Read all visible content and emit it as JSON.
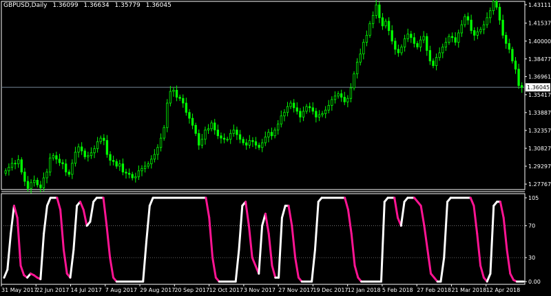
{
  "header": {
    "symbol": "GBPUSD,Daily",
    "open": "1.36099",
    "high": "1.36634",
    "low": "1.35779",
    "close": "1.36045"
  },
  "colors": {
    "background": "#000000",
    "bull_candle": "#00ff00",
    "bear_candle": "#00ff00",
    "bid_line": "#778899",
    "osc_up": "#ffffff",
    "osc_down": "#ff1493",
    "level_line": "#888888"
  },
  "price_axis": {
    "labels": [
      "1.43111",
      "1.41537",
      "1.40000",
      "1.38477",
      "1.36961",
      "1.35417",
      "1.33887",
      "1.32357",
      "1.30827",
      "1.29297",
      "1.27767"
    ],
    "current_price": "1.36045"
  },
  "oscillator_axis": {
    "labels": [
      "105",
      "70",
      "30",
      "0.00"
    ],
    "levels": [
      70,
      30
    ]
  },
  "time_axis": {
    "labels": [
      "31 May 2017",
      "22 Jun 2017",
      "14 Jul 2017",
      "7 Aug 2017",
      "29 Aug 2017",
      "20 Sep 2017",
      "12 Oct 2017",
      "3 Nov 2017",
      "27 Nov 2017",
      "19 Dec 2017",
      "12 Jan 2018",
      "5 Feb 2018",
      "27 Feb 2018",
      "21 Mar 2018",
      "12 Apr 2018"
    ]
  },
  "chart_data": [
    {
      "type": "candlestick",
      "symbol": "GBPUSD",
      "timeframe": "Daily",
      "ylim": [
        1.273,
        1.434
      ],
      "close_series": [
        1.289,
        1.292,
        1.2955,
        1.295,
        1.2985,
        1.288,
        1.28,
        1.274,
        1.279,
        1.281,
        1.277,
        1.2745,
        1.283,
        1.288,
        1.3,
        1.302,
        1.299,
        1.296,
        1.295,
        1.288,
        1.286,
        1.2955,
        1.305,
        1.3095,
        1.306,
        1.301,
        1.302,
        1.3045,
        1.308,
        1.314,
        1.317,
        1.315,
        1.303,
        1.298,
        1.297,
        1.293,
        1.295,
        1.288,
        1.287,
        1.286,
        1.283,
        1.284,
        1.289,
        1.291,
        1.293,
        1.295,
        1.299,
        1.303,
        1.309,
        1.317,
        1.326,
        1.347,
        1.357,
        1.358,
        1.352,
        1.351,
        1.347,
        1.339,
        1.334,
        1.328,
        1.321,
        1.311,
        1.316,
        1.324,
        1.325,
        1.33,
        1.324,
        1.319,
        1.317,
        1.316,
        1.316,
        1.321,
        1.324,
        1.32,
        1.316,
        1.313,
        1.311,
        1.315,
        1.314,
        1.311,
        1.309,
        1.313,
        1.318,
        1.322,
        1.319,
        1.324,
        1.329,
        1.336,
        1.339,
        1.344,
        1.347,
        1.343,
        1.34,
        1.335,
        1.34,
        1.344,
        1.343,
        1.34,
        1.335,
        1.337,
        1.338,
        1.341,
        1.345,
        1.35,
        1.353,
        1.355,
        1.352,
        1.348,
        1.351,
        1.36,
        1.372,
        1.382,
        1.389,
        1.399,
        1.405,
        1.415,
        1.422,
        1.431,
        1.42,
        1.413,
        1.417,
        1.409,
        1.4,
        1.393,
        1.39,
        1.395,
        1.402,
        1.406,
        1.403,
        1.398,
        1.395,
        1.401,
        1.404,
        1.392,
        1.383,
        1.379,
        1.386,
        1.39,
        1.395,
        1.399,
        1.404,
        1.403,
        1.399,
        1.407,
        1.414,
        1.421,
        1.418,
        1.409,
        1.405,
        1.408,
        1.41,
        1.414,
        1.42,
        1.426,
        1.434,
        1.429,
        1.418,
        1.405,
        1.398,
        1.393,
        1.383,
        1.376,
        1.362,
        1.3604
      ],
      "bid_price": 1.36045
    },
    {
      "type": "line",
      "name": "oscillator",
      "ylim": [
        0,
        105
      ],
      "levels": [
        70,
        30
      ],
      "values": [
        5,
        15,
        60,
        95,
        80,
        20,
        8,
        5,
        10,
        8,
        5,
        3,
        60,
        95,
        105,
        105,
        105,
        90,
        40,
        10,
        5,
        40,
        95,
        100,
        90,
        70,
        75,
        100,
        105,
        105,
        105,
        70,
        30,
        5,
        0,
        0,
        0,
        0,
        0,
        0,
        0,
        0,
        0,
        50,
        95,
        105,
        105,
        105,
        105,
        105,
        105,
        105,
        105,
        105,
        105,
        105,
        105,
        105,
        105,
        105,
        105,
        105,
        80,
        30,
        5,
        0,
        0,
        0,
        0,
        0,
        0,
        40,
        95,
        100,
        70,
        30,
        20,
        10,
        70,
        85,
        60,
        20,
        5,
        5,
        80,
        95,
        95,
        70,
        30,
        5,
        0,
        0,
        0,
        0,
        40,
        100,
        105,
        105,
        105,
        105,
        105,
        105,
        105,
        105,
        90,
        60,
        20,
        5,
        0,
        0,
        0,
        0,
        0,
        0,
        0,
        100,
        105,
        105,
        105,
        80,
        70,
        100,
        105,
        105,
        105,
        100,
        95,
        70,
        40,
        10,
        5,
        0,
        0,
        30,
        100,
        105,
        105,
        105,
        105,
        105,
        105,
        105,
        95,
        60,
        20,
        5,
        0,
        10,
        95,
        100,
        100,
        80,
        40,
        10,
        2,
        0,
        0,
        0
      ]
    }
  ]
}
